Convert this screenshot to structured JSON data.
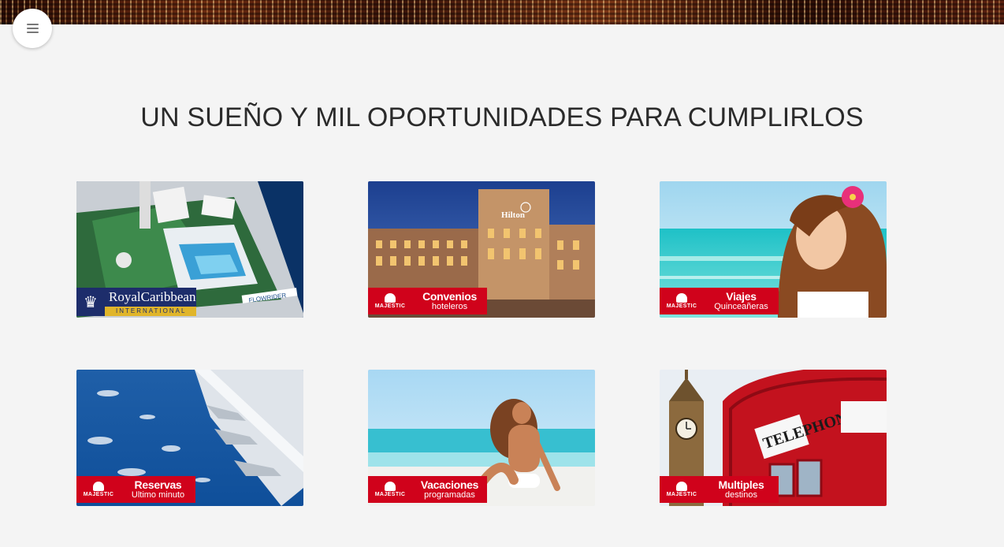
{
  "header": {
    "menu_icon": "hamburger-icon"
  },
  "page_title": "UN SUEÑO Y MIL OPORTUNIDADES PARA CUMPLIRLOS",
  "cards": [
    {
      "name": "card-royal-caribbean",
      "brand": "RoyalCaribbean",
      "brand_sub": "INTERNATIONAL",
      "deck_sign": "FLOWRIDER",
      "colors": {
        "navy": "#1d2d6b",
        "gold": "#e0b52a"
      }
    },
    {
      "name": "card-convenios",
      "logo_text": "MAJESTIC",
      "line1": "Convenios",
      "line2": "hoteleros",
      "sign": "Hilton"
    },
    {
      "name": "card-viajes",
      "logo_text": "MAJESTIC",
      "line1": "Viajes",
      "line2": "Quinceañeras"
    },
    {
      "name": "card-reservas",
      "logo_text": "MAJESTIC",
      "line1": "Reservas",
      "line2": "Ultimo minuto"
    },
    {
      "name": "card-vacaciones",
      "logo_text": "MAJESTIC",
      "line1": "Vacaciones",
      "line2": "programadas"
    },
    {
      "name": "card-multiples",
      "logo_text": "MAJESTIC",
      "line1": "Multiples",
      "line2": "destinos",
      "sign": "TELEPHONE"
    }
  ],
  "colors": {
    "background": "#f4f4f4",
    "badge_red": "#d0021b",
    "title": "#2b2b2b"
  }
}
